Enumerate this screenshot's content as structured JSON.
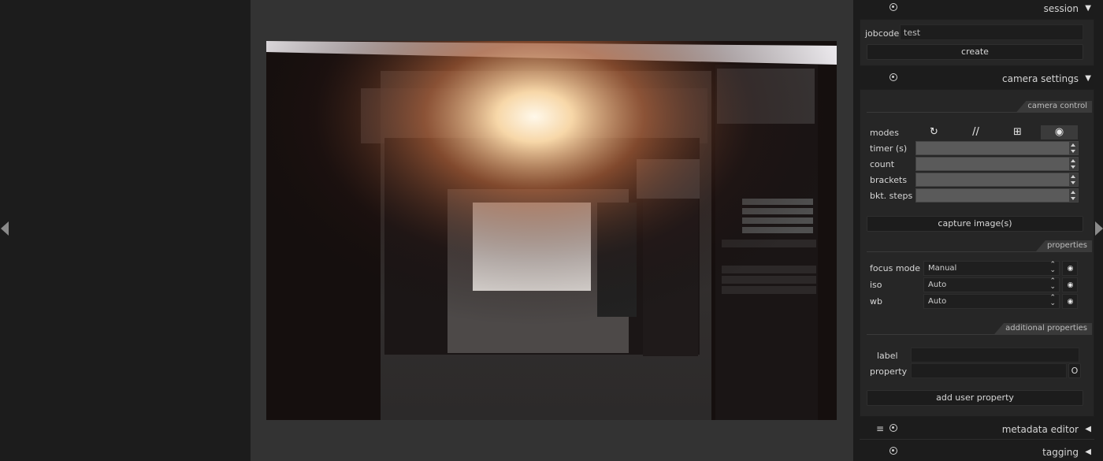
{
  "session": {
    "title": "session",
    "jobcode_label": "jobcode",
    "jobcode_value": "test",
    "create_label": "create"
  },
  "camera_settings": {
    "title": "camera settings",
    "section_camera_control": "camera control",
    "modes_label": "modes",
    "mode_icons": [
      "self-timer-icon",
      "timelapse-icon",
      "bracket-icon",
      "live-view-eye-icon"
    ],
    "timer_label": "timer (s)",
    "count_label": "count",
    "brackets_label": "brackets",
    "bkt_steps_label": "bkt. steps",
    "capture_label": "capture image(s)",
    "section_properties": "properties",
    "properties": [
      {
        "label": "focus mode",
        "value": "Manual"
      },
      {
        "label": "iso",
        "value": "Auto"
      },
      {
        "label": "wb",
        "value": "Auto"
      }
    ],
    "section_additional": "additional properties",
    "label_label": "label",
    "property_label": "property",
    "property_btn": "O",
    "add_user_property_label": "add user property"
  },
  "metadata_editor": {
    "title": "metadata editor"
  },
  "tagging": {
    "title": "tagging"
  },
  "colors": {
    "panel_bg": "#1c1c1c",
    "center_bg": "#333333",
    "module_bg": "#262626"
  }
}
